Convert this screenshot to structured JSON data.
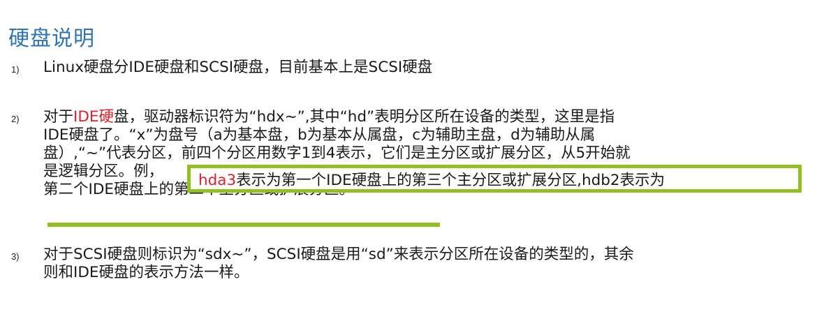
{
  "title": "硬盘说明",
  "items": [
    {
      "number": "1)",
      "lines": [
        "Linux硬盘分IDE硬盘和SCSI硬盘，目前基本上是SCSI硬盘"
      ]
    },
    {
      "number": "2)",
      "line1_a": "对于",
      "line1_red": "IDE硬",
      "line1_b": "盘，驱动器标识符为“hdx~”,其中“hd”表明分区所在设备的类型，这里是指",
      "line2": "IDE硬盘了。“x”为盘号（a为基本盘，b为基本从属盘，c为辅助主盘，d为辅助从属",
      "line3": "盘）,“~”代表分区，前四个分区用数字1到4表示，它们是主分区或扩展分区，从5开始就",
      "line4": "是逻辑分区。例，",
      "line5": "第二个IDE硬盘上的第二个主分区或扩展分区。"
    },
    {
      "number": "3)",
      "lines": [
        "对于SCSI硬盘则标识为“sdx~”，SCSI硬盘是用“sd”来表示分区所在设备的类型的，其余",
        "则和IDE硬盘的表示方法一样。"
      ]
    }
  ],
  "highlight": {
    "red_text": "hda3",
    "text": "表示为第一个IDE硬盘上的第三个主分区或扩展分区,hdb2表示为"
  },
  "colors": {
    "title": "#2e74b5",
    "red": "#e0202c",
    "highlight_border": "#92c01f"
  }
}
